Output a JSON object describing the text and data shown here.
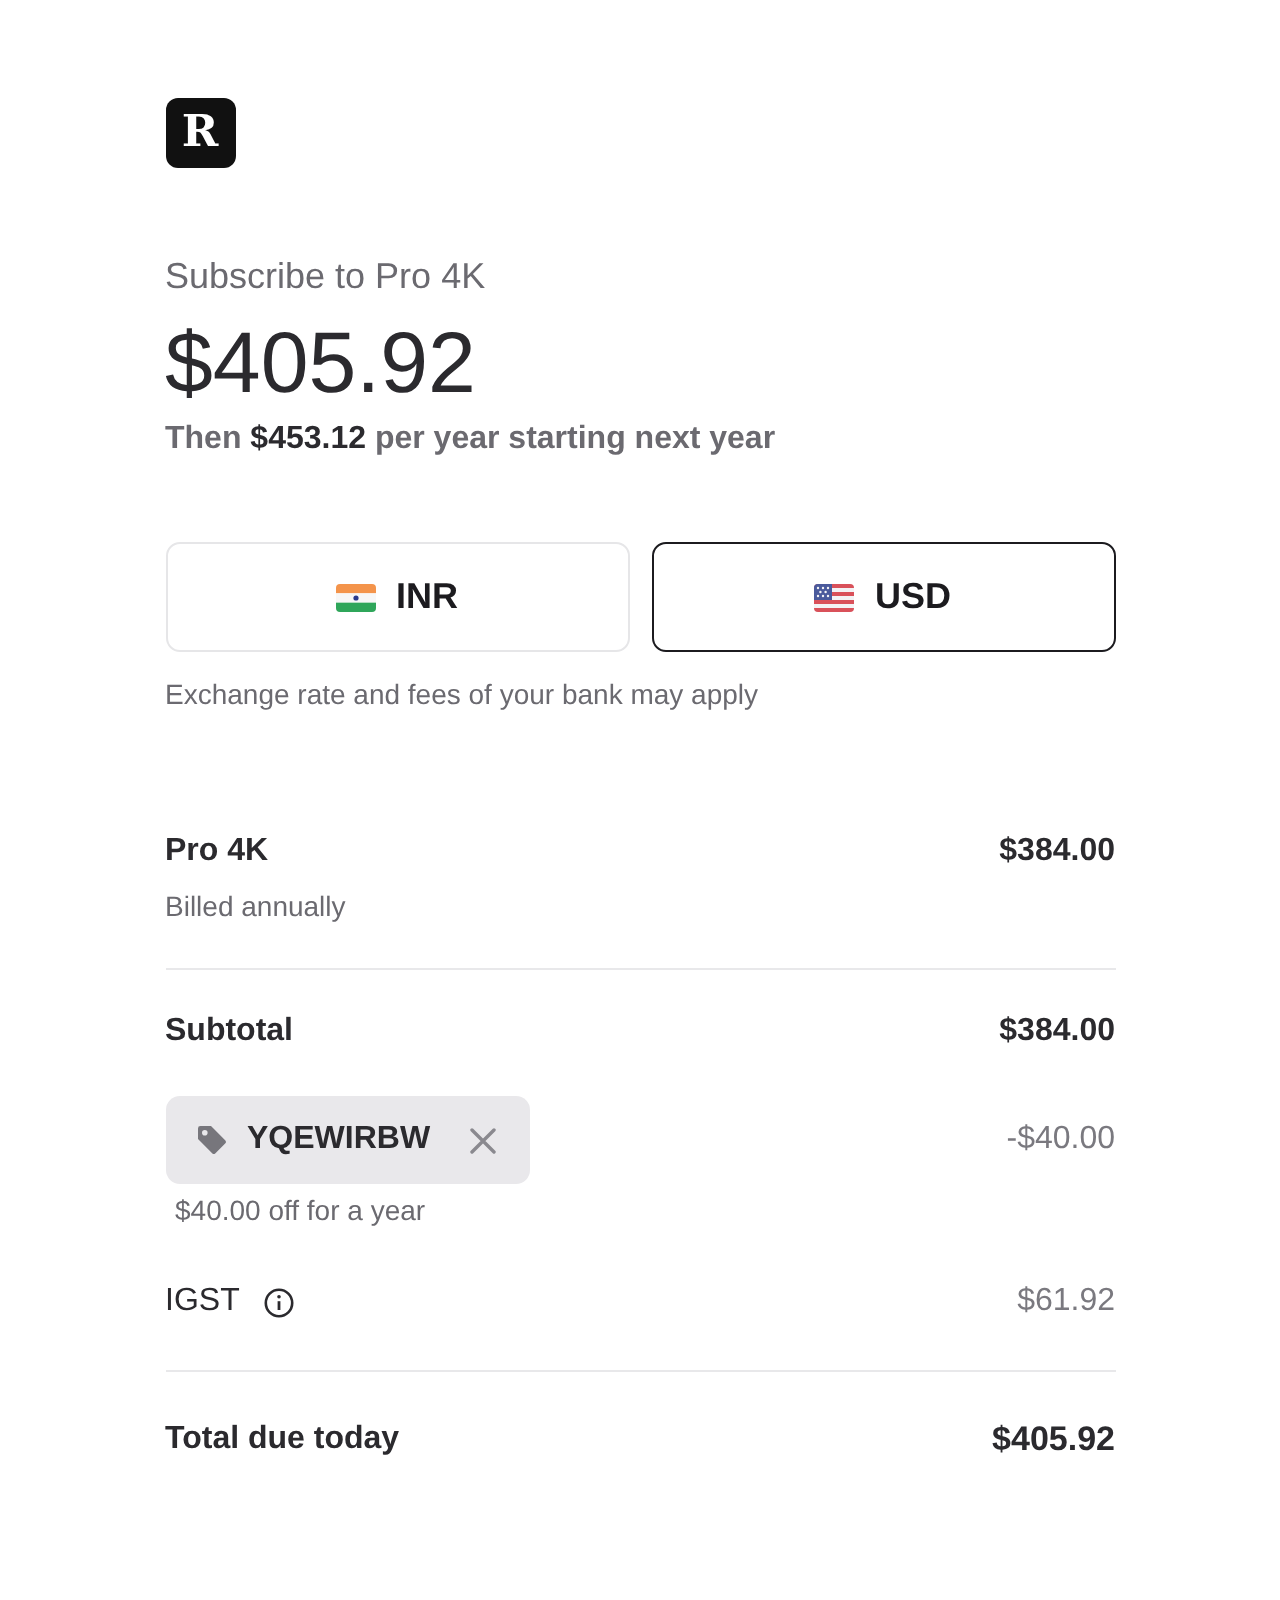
{
  "logo": {
    "letter": "R"
  },
  "header": {
    "title": "Subscribe to Pro 4K",
    "price": "$405.92",
    "renewal": "Then **$453.12** per year starting next year"
  },
  "currencies": [
    {
      "code": "INR",
      "kind": "india",
      "selected": false
    },
    {
      "code": "USD",
      "kind": "us",
      "selected": true
    }
  ],
  "currency_note": "Exchange rate and fees of your bank may apply",
  "summary": {
    "product": {
      "name": "Pro 4K",
      "billing": "Billed annually",
      "amount": "$384.00"
    },
    "subtotal": {
      "label": "Subtotal",
      "amount": "$384.00"
    },
    "coupon": {
      "code": "YQEWIRBW",
      "amount": "-$40.00",
      "note": "$40.00 off for a year"
    },
    "tax": {
      "label": "IGST",
      "amount": "$61.92"
    },
    "total": {
      "label": "Total due today",
      "amount": "$405.92"
    }
  }
}
